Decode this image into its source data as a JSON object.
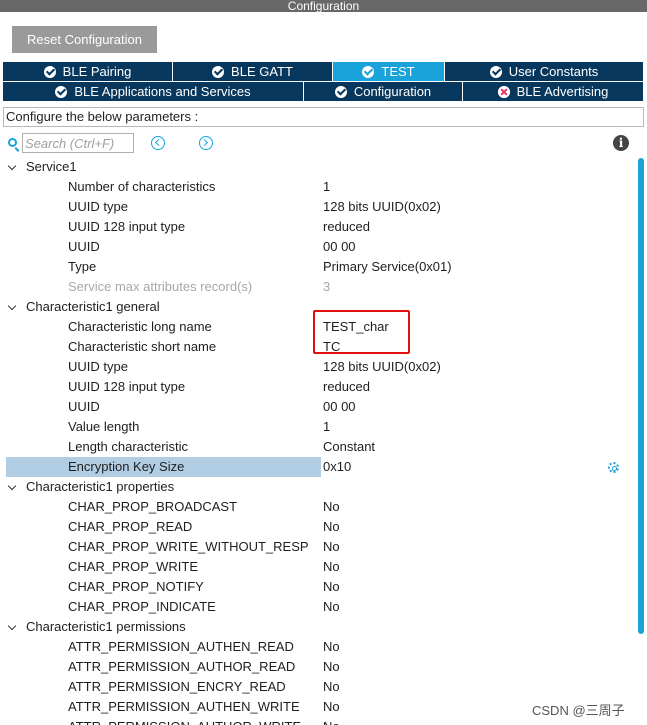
{
  "window": {
    "title": "Configuration"
  },
  "toolbar": {
    "reset_label": "Reset Configuration"
  },
  "tabs_row1": [
    {
      "label": "BLE Pairing",
      "status": "ok",
      "active": false
    },
    {
      "label": "BLE GATT",
      "status": "ok",
      "active": false
    },
    {
      "label": "TEST",
      "status": "ok",
      "active": true
    },
    {
      "label": "User Constants",
      "status": "ok",
      "active": false
    }
  ],
  "tabs_row2": [
    {
      "label": "BLE Applications and Services",
      "status": "ok",
      "active": false
    },
    {
      "label": "Configuration",
      "status": "ok",
      "active": false
    },
    {
      "label": "BLE Advertising",
      "status": "error",
      "active": false
    }
  ],
  "params_header": "Configure the below parameters :",
  "search": {
    "placeholder": "Search (Ctrl+F)",
    "value": ""
  },
  "groups": [
    {
      "label": "Service1",
      "params": [
        {
          "label": "Number of characteristics",
          "value": "1"
        },
        {
          "label": "UUID type",
          "value": "128 bits UUID(0x02)"
        },
        {
          "label": "UUID 128 input type",
          "value": "reduced"
        },
        {
          "label": "UUID",
          "value": "00 00"
        },
        {
          "label": "Type",
          "value": "Primary Service(0x01)"
        },
        {
          "label": "Service max attributes record(s)",
          "value": "3",
          "disabled": true
        }
      ]
    },
    {
      "label": "Characteristic1 general",
      "params": [
        {
          "label": "Characteristic long name",
          "value": "TEST_char"
        },
        {
          "label": "Characteristic short name",
          "value": "TC"
        },
        {
          "label": "UUID type",
          "value": "128 bits UUID(0x02)"
        },
        {
          "label": "UUID 128 input type",
          "value": "reduced"
        },
        {
          "label": "UUID",
          "value": "00 00"
        },
        {
          "label": "Value length",
          "value": "1"
        },
        {
          "label": "Length characteristic",
          "value": "Constant"
        },
        {
          "label": "Encryption Key Size",
          "value": "0x10",
          "selected": true
        }
      ]
    },
    {
      "label": "Characteristic1 properties",
      "params": [
        {
          "label": "CHAR_PROP_BROADCAST",
          "value": "No"
        },
        {
          "label": "CHAR_PROP_READ",
          "value": "No"
        },
        {
          "label": "CHAR_PROP_WRITE_WITHOUT_RESP",
          "value": "No"
        },
        {
          "label": "CHAR_PROP_WRITE",
          "value": "No"
        },
        {
          "label": "CHAR_PROP_NOTIFY",
          "value": "No"
        },
        {
          "label": "CHAR_PROP_INDICATE",
          "value": "No"
        }
      ]
    },
    {
      "label": "Characteristic1 permissions",
      "params": [
        {
          "label": "ATTR_PERMISSION_AUTHEN_READ",
          "value": "No"
        },
        {
          "label": "ATTR_PERMISSION_AUTHOR_READ",
          "value": "No"
        },
        {
          "label": "ATTR_PERMISSION_ENCRY_READ",
          "value": "No"
        },
        {
          "label": "ATTR_PERMISSION_AUTHEN_WRITE",
          "value": "No"
        },
        {
          "label": "ATTR_PERMISSION_AUTHOR_WRITE",
          "value": "No"
        }
      ]
    }
  ],
  "watermark": "CSDN @三周子",
  "colors": {
    "tab": "#07375d",
    "tab_active": "#1aa3d9",
    "selection": "#b1cde4",
    "highlight_box": "#e01010"
  }
}
